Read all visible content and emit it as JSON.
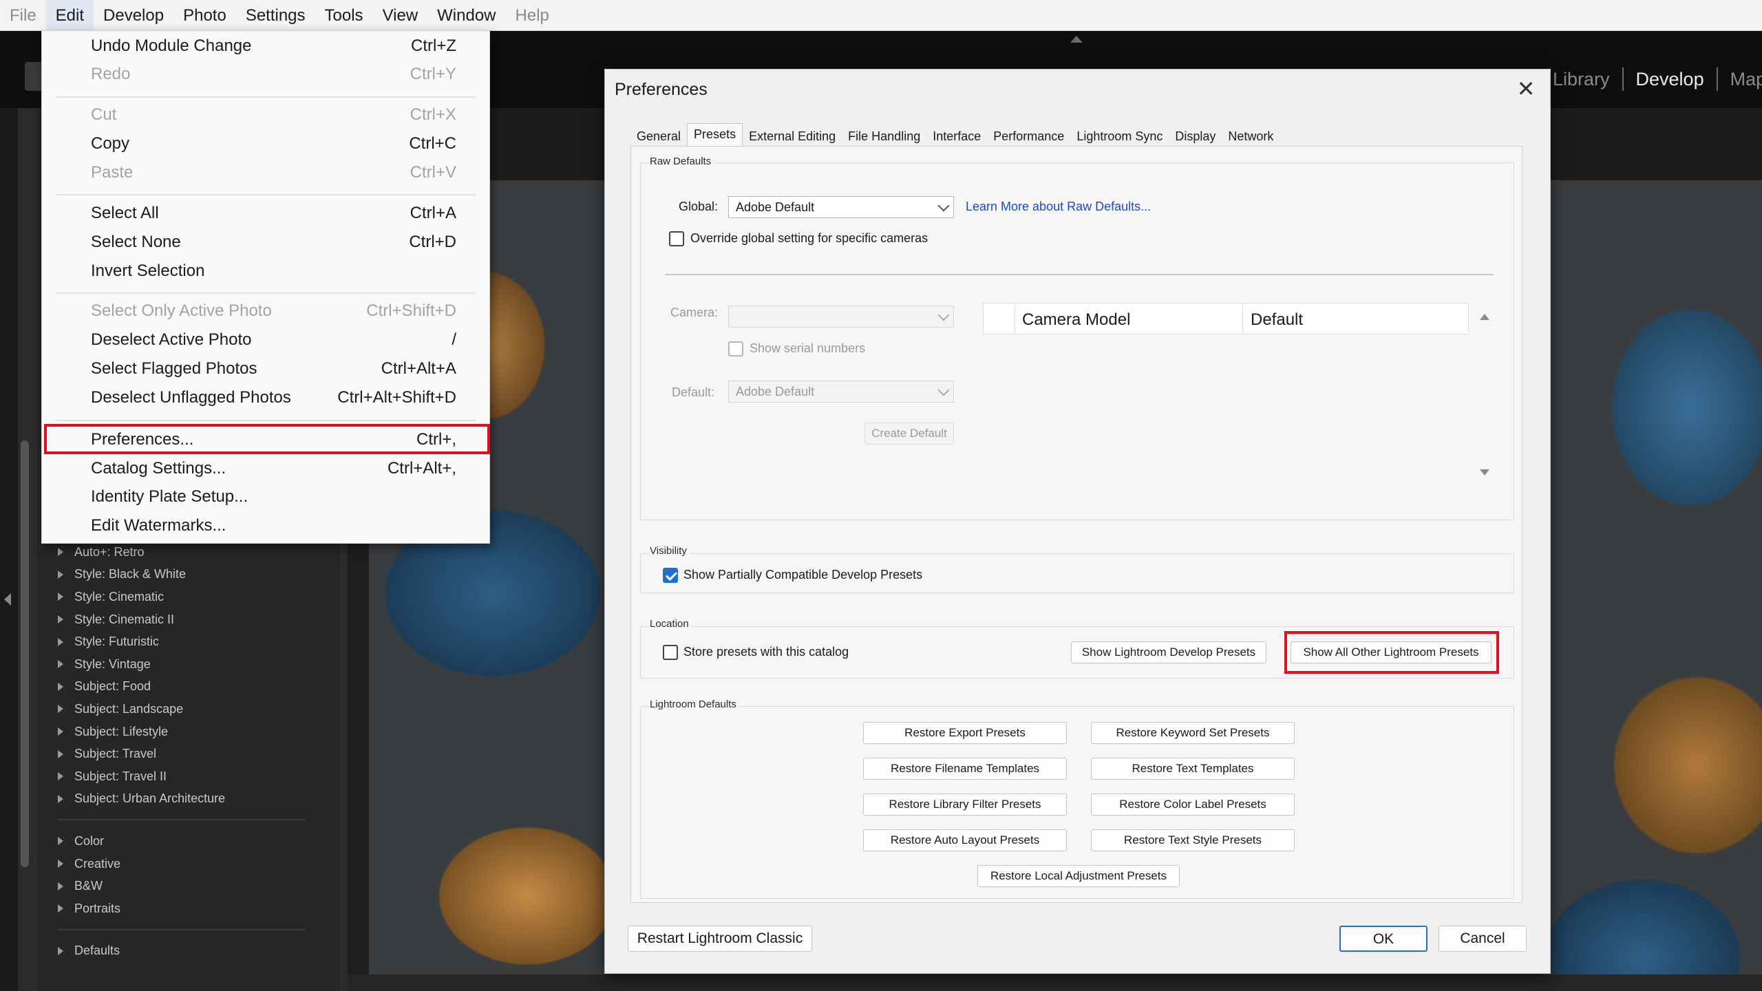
{
  "menubar": {
    "items": [
      {
        "label": "File",
        "dim": true
      },
      {
        "label": "Edit",
        "selected": true
      },
      {
        "label": "Develop"
      },
      {
        "label": "Photo"
      },
      {
        "label": "Settings"
      },
      {
        "label": "Tools"
      },
      {
        "label": "View"
      },
      {
        "label": "Window"
      },
      {
        "label": "Help",
        "dim": true
      }
    ]
  },
  "modules": {
    "library": "Library",
    "develop": "Develop",
    "map": "Map"
  },
  "edit_menu": {
    "items": [
      {
        "label": "Undo Module Change",
        "shortcut": "Ctrl+Z"
      },
      {
        "label": "Redo",
        "shortcut": "Ctrl+Y",
        "disabled": true
      },
      {
        "label": "Cut",
        "shortcut": "Ctrl+X",
        "disabled": true
      },
      {
        "label": "Copy",
        "shortcut": "Ctrl+C"
      },
      {
        "label": "Paste",
        "shortcut": "Ctrl+V",
        "disabled": true
      },
      {
        "label": "Select All",
        "shortcut": "Ctrl+A"
      },
      {
        "label": "Select None",
        "shortcut": "Ctrl+D"
      },
      {
        "label": "Invert Selection",
        "shortcut": ""
      },
      {
        "label": "Select Only Active Photo",
        "shortcut": "Ctrl+Shift+D",
        "disabled": true
      },
      {
        "label": "Deselect Active Photo",
        "shortcut": "/"
      },
      {
        "label": "Select Flagged Photos",
        "shortcut": "Ctrl+Alt+A"
      },
      {
        "label": "Deselect Unflagged Photos",
        "shortcut": "Ctrl+Alt+Shift+D"
      },
      {
        "label": "Preferences...",
        "shortcut": "Ctrl+,",
        "highlighted": true
      },
      {
        "label": "Catalog Settings...",
        "shortcut": "Ctrl+Alt+,"
      },
      {
        "label": "Identity Plate Setup...",
        "shortcut": ""
      },
      {
        "label": "Edit Watermarks...",
        "shortcut": ""
      }
    ]
  },
  "preset_list": {
    "group1": [
      "Auto+: Retro",
      "Style: Black & White",
      "Style: Cinematic",
      "Style: Cinematic II",
      "Style: Futuristic",
      "Style: Vintage",
      "Subject: Food",
      "Subject: Landscape",
      "Subject: Lifestyle",
      "Subject: Travel",
      "Subject: Travel II",
      "Subject: Urban Architecture"
    ],
    "group2": [
      "Color",
      "Creative",
      "B&W",
      "Portraits"
    ],
    "group3": [
      "Defaults"
    ]
  },
  "preferences": {
    "title": "Preferences",
    "tabs": [
      "General",
      "Presets",
      "External Editing",
      "File Handling",
      "Interface",
      "Performance",
      "Lightroom Sync",
      "Display",
      "Network"
    ],
    "active_tab": "Presets",
    "raw_defaults": {
      "title": "Raw Defaults",
      "global_label": "Global:",
      "global_value": "Adobe Default",
      "learn_more": "Learn More about Raw Defaults...",
      "override_label": "Override global setting for specific cameras",
      "override_checked": false,
      "camera_label": "Camera:",
      "camera_value": "",
      "show_serial": "Show serial numbers",
      "default_label": "Default:",
      "default_value": "Adobe Default",
      "create_default": "Create Default",
      "table_headers": [
        "Camera Model",
        "Default"
      ]
    },
    "visibility": {
      "title": "Visibility",
      "show_partial": "Show Partially Compatible Develop Presets",
      "show_partial_checked": true
    },
    "location": {
      "title": "Location",
      "store_presets": "Store presets with this catalog",
      "store_checked": false,
      "show_develop": "Show Lightroom Develop Presets",
      "show_other": "Show All Other Lightroom Presets"
    },
    "lightroom_defaults": {
      "title": "Lightroom Defaults",
      "buttons": [
        "Restore Export Presets",
        "Restore Keyword Set Presets",
        "Restore Filename Templates",
        "Restore Text Templates",
        "Restore Library Filter Presets",
        "Restore Color Label Presets",
        "Restore Auto Layout Presets",
        "Restore Text Style Presets",
        "Restore Local Adjustment Presets"
      ]
    },
    "restart": "Restart Lightroom Classic",
    "ok": "OK",
    "cancel": "Cancel"
  },
  "colors": {
    "highlight": "#e0101c",
    "accent": "#1f6fd1",
    "link": "#1f47c7"
  }
}
